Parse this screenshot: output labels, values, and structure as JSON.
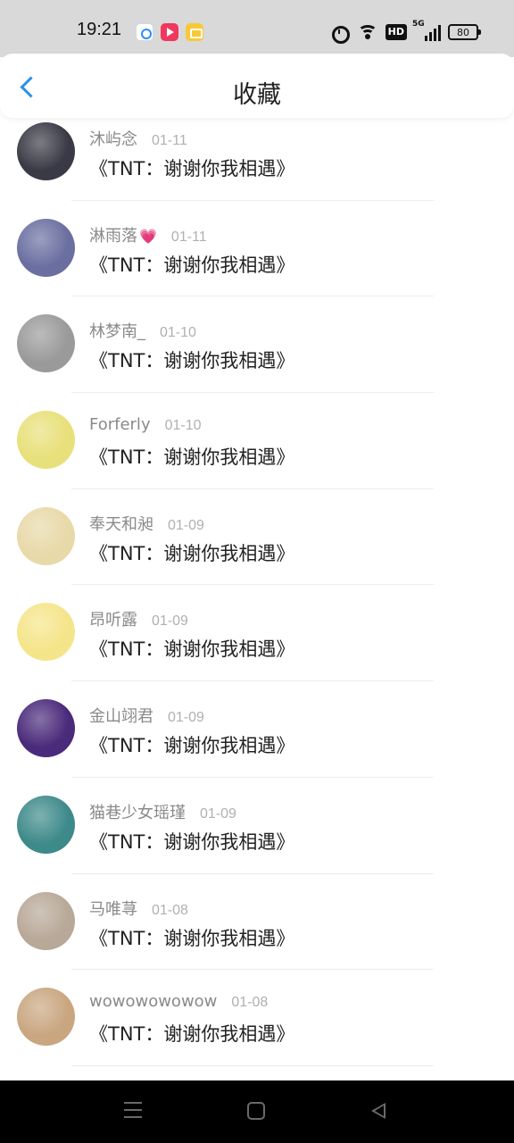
{
  "status_bar": {
    "time": "19:21",
    "battery": "80",
    "hd_label": "HD",
    "network_label": "5G"
  },
  "header": {
    "title": "收藏"
  },
  "items": [
    {
      "name": "沐屿念",
      "date": "01-11",
      "text": "《TNT：谢谢你我相遇》",
      "avatar_color": "#3a3a46"
    },
    {
      "name": "淋雨落",
      "emoji": "💗",
      "date": "01-11",
      "text": "《TNT：谢谢你我相遇》",
      "avatar_color": "#6a6fa0"
    },
    {
      "name": "林梦南_",
      "date": "01-10",
      "text": "《TNT：谢谢你我相遇》",
      "avatar_color": "#9a9a9a"
    },
    {
      "name": "Forferly",
      "date": "01-10",
      "text": "《TNT：谢谢你我相遇》",
      "avatar_color": "#e8e07a"
    },
    {
      "name": "奉天和昶",
      "date": "01-09",
      "text": "《TNT：谢谢你我相遇》",
      "avatar_color": "#e8d9a8"
    },
    {
      "name": "昂听露",
      "date": "01-09",
      "text": "《TNT：谢谢你我相遇》",
      "avatar_color": "#f5e58a"
    },
    {
      "name": "金山翊君",
      "date": "01-09",
      "text": "《TNT：谢谢你我相遇》",
      "avatar_color": "#4a2a7a"
    },
    {
      "name": "猫巷少女瑶瑾",
      "date": "01-09",
      "text": "《TNT：谢谢你我相遇》",
      "avatar_color": "#3e8a8a"
    },
    {
      "name": "马唯荨",
      "date": "01-08",
      "text": "《TNT：谢谢你我相遇》",
      "avatar_color": "#b8a898"
    },
    {
      "name": "wowowowowow",
      "date": "01-08",
      "text": "《TNT：谢谢你我相遇》",
      "avatar_color": "#c9a680"
    }
  ]
}
